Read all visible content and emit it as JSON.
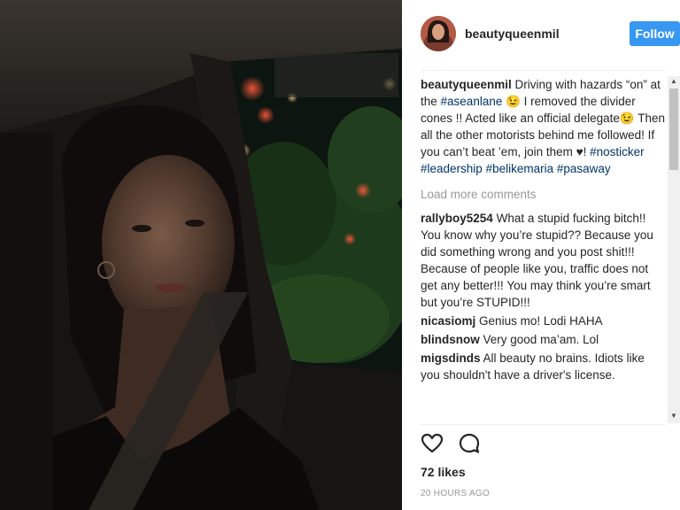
{
  "post": {
    "username": "beautyqueenmil",
    "follow_label": "Follow",
    "likes": "72 likes",
    "timestamp": "20 HOURS AGO"
  },
  "caption": {
    "username": "beautyqueenmil",
    "t1": " Driving with hazards “on” at the ",
    "tag1": "#aseanlane",
    "t2": " 😉 I removed the divider cones !! Acted like an official delegate😉 Then all the other motorists behind me followed! If you can’t beat ’em, join them ♥! ",
    "tag2": "#nosticker",
    "tag3": "#leadership",
    "tag4": "#belikemaria",
    "tag5": "#pasaway"
  },
  "load_more": "Load more comments",
  "comments": [
    {
      "user": "rallyboy5254",
      "text": "What a stupid fucking bitch!! You know why you’re stupid?? Because you did something wrong and you post shit!!! Because of people like you, traffic does not get any better!!! You may think you’re smart but you’re STUPID!!!"
    },
    {
      "user": "nicasiomj",
      "text": "Genius mo! Lodi HAHA"
    },
    {
      "user": "blindsnow",
      "text": "Very good ma’am. Lol"
    },
    {
      "user": "migsdinds",
      "text": "All beauty no brains. Idiots like you shouldn't have a driver's license."
    }
  ],
  "icons": {
    "like": "heart-icon",
    "comment": "comment-bubble-icon"
  },
  "colors": {
    "follow_button": "#3897f0",
    "hashtag": "#003569",
    "muted_text": "#999999"
  }
}
